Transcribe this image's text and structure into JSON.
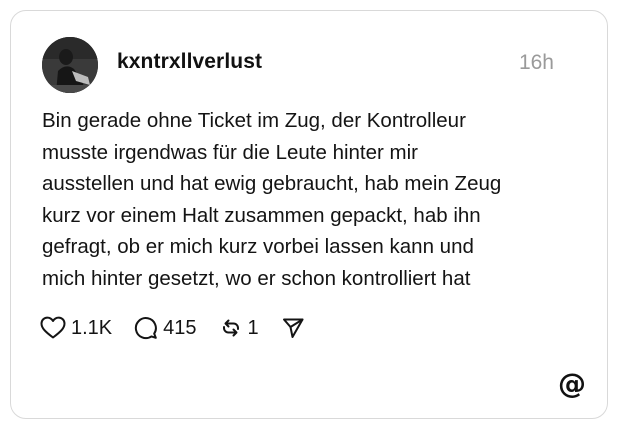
{
  "post": {
    "username": "kxntrxllverlust",
    "timestamp": "16h",
    "text": "Bin gerade ohne Ticket im Zug, der Kontrolleur\nmusste irgendwas für die Leute hinter mir\nausstellen und hat ewig gebraucht, hab mein Zeug\nkurz vor einem Halt zusammen gepackt, hab ihn\ngefragt, ob er mich kurz vorbei lassen kann und\nmich hinter gesetzt, wo er schon kontrolliert hat"
  },
  "actions": {
    "likes": "1.1K",
    "replies": "415",
    "reposts": "1"
  },
  "icons": {
    "like": "heart-icon",
    "reply": "speech-bubble-icon",
    "repost": "repost-icon",
    "share": "send-icon",
    "brand": "threads-logo-icon"
  },
  "brand": {
    "logo_glyph": "@"
  },
  "colors": {
    "border": "#d9d9d9",
    "text": "#141414",
    "muted": "#9a9a9a",
    "background": "#ffffff"
  }
}
